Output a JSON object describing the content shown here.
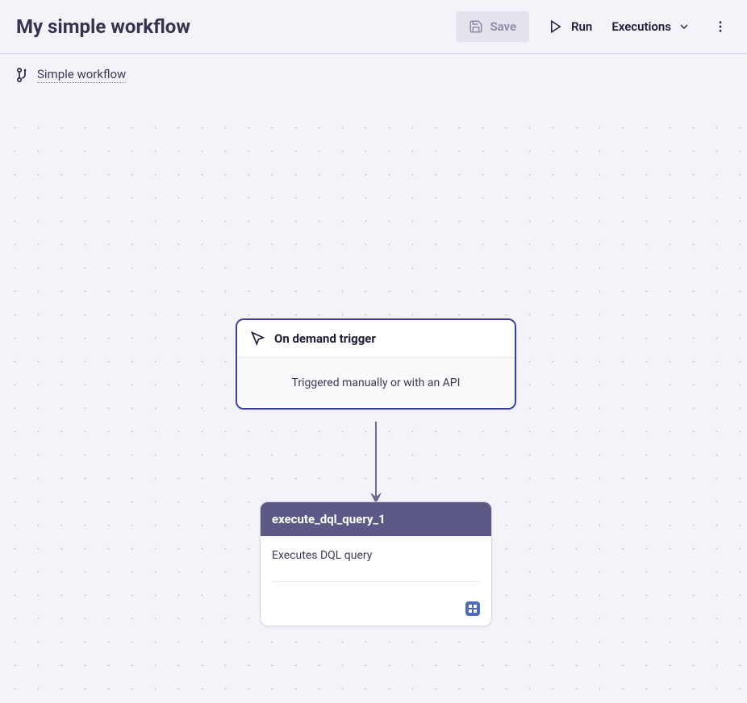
{
  "header": {
    "title": "My simple workflow",
    "save_label": "Save",
    "run_label": "Run",
    "executions_label": "Executions"
  },
  "breadcrumb": {
    "label": "Simple workflow"
  },
  "workflow": {
    "trigger": {
      "title": "On demand trigger",
      "description": "Triggered manually or with an API"
    },
    "query": {
      "title": "execute_dql_query_1",
      "description": "Executes DQL query"
    }
  }
}
